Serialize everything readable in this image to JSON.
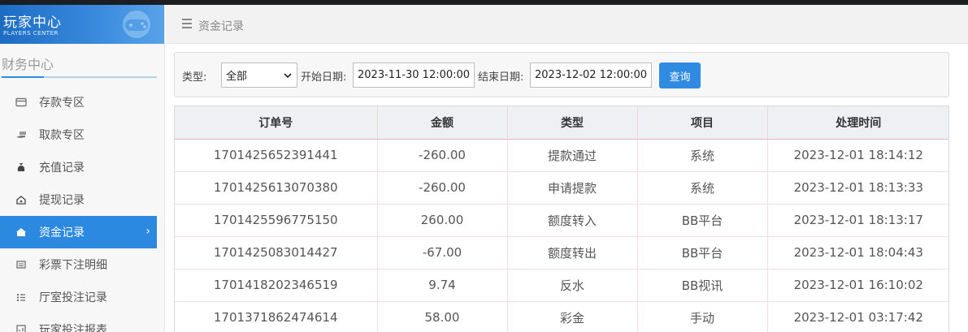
{
  "brand": {
    "title": "玩家中心",
    "subtitle": "PLAYERS CENTER"
  },
  "sidebar": {
    "section_title": "财务中心",
    "items": [
      {
        "label": "存款专区",
        "icon": "card-icon",
        "active": false
      },
      {
        "label": "取款专区",
        "icon": "cash-hand-icon",
        "active": false
      },
      {
        "label": "充值记录",
        "icon": "money-bag-icon",
        "active": false
      },
      {
        "label": "提现记录",
        "icon": "withdraw-icon",
        "active": false
      },
      {
        "label": "资金记录",
        "icon": "home-icon",
        "active": true
      },
      {
        "label": "彩票下注明细",
        "icon": "list-icon",
        "active": false
      },
      {
        "label": "厅室投注记录",
        "icon": "list-bullets-icon",
        "active": false
      },
      {
        "label": "玩家投注报表",
        "icon": "report-icon",
        "active": false
      }
    ]
  },
  "header": {
    "title": "资金记录"
  },
  "filter": {
    "type_label": "类型:",
    "type_value": "全部",
    "start_label": "开始日期:",
    "start_value": "2023-11-30 12:00:00",
    "end_label": "结束日期:",
    "end_value": "2023-12-02 12:00:00",
    "query_label": "查询"
  },
  "table": {
    "columns": [
      "订单号",
      "金额",
      "类型",
      "项目",
      "处理时间"
    ],
    "rows": [
      [
        "1701425652391441",
        "-260.00",
        "提款通过",
        "系统",
        "2023-12-01 18:14:12"
      ],
      [
        "1701425613070380",
        "-260.00",
        "申请提款",
        "系统",
        "2023-12-01 18:13:33"
      ],
      [
        "1701425596775150",
        "260.00",
        "额度转入",
        "BB平台",
        "2023-12-01 18:13:17"
      ],
      [
        "1701425083014427",
        "-67.00",
        "额度转出",
        "BB平台",
        "2023-12-01 18:04:43"
      ],
      [
        "1701418202346519",
        "9.74",
        "反水",
        "BB视讯",
        "2023-12-01 16:10:02"
      ],
      [
        "1701371862474614",
        "58.00",
        "彩金",
        "手动",
        "2023-12-01 03:17:42"
      ]
    ]
  },
  "colors": {
    "accent": "#2b8ae0",
    "sidebar_bg": "#f7f7f7",
    "header_bg": "#f2f2f2"
  }
}
